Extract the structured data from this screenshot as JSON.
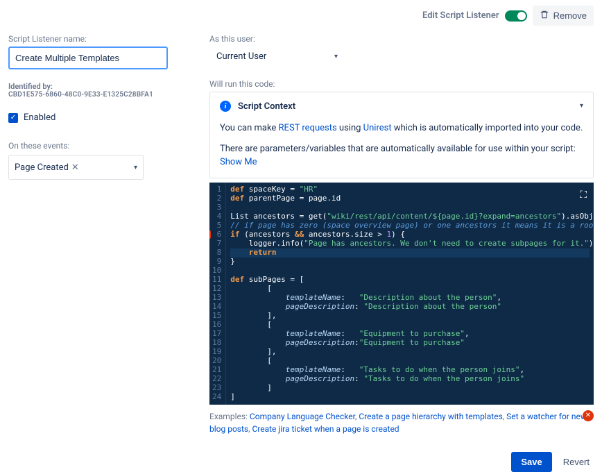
{
  "topbar": {
    "edit_label": "Edit Script Listener",
    "remove_label": "Remove"
  },
  "left": {
    "name_label": "Script Listener name:",
    "name_value": "Create Multiple Templates",
    "identified_label": "Identified by:",
    "guid": "CBD1E575-6860-48C0-9E33-E1325C28BFA1",
    "enabled_label": "Enabled",
    "events_label": "On these events:",
    "event_tag": "Page Created"
  },
  "right": {
    "user_label": "As this user:",
    "user_value": "Current User",
    "code_label": "Will run this code:",
    "ctx_title": "Script Context",
    "ctx_line1_pre": "You can make ",
    "ctx_line1_link1": "REST requests",
    "ctx_line1_mid": " using ",
    "ctx_line1_link2": "Unirest",
    "ctx_line1_post": " which is automatically imported into your code.",
    "ctx_line2_pre": "There are parameters/variables that are automatically available for use within your script: ",
    "ctx_line2_link": "Show Me"
  },
  "code": {
    "lines": [
      {
        "n": "1",
        "html": "<span class='kw'>def</span> <span class='plain'>spaceKey =</span> <span class='str'>\"HR\"</span>"
      },
      {
        "n": "2",
        "html": "<span class='kw'>def</span> <span class='plain'>parentPage = page.id</span>"
      },
      {
        "n": "3",
        "html": ""
      },
      {
        "n": "4",
        "html": "<span class='plain'>List ancestors = get(</span><span class='str'>\"wiki/rest/api/content/${page.id}?expand=ancestors\"</span><span class='plain'>).asObject(Map).body</span>"
      },
      {
        "n": "5",
        "html": "<span class='comment'>// if page has zero (space overview page) or one ancestors it means it is a root page</span>"
      },
      {
        "n": "6",
        "err": true,
        "html": "<span class='kw'>if</span> <span class='plain'>(ancestors </span><span class='kw'>&&</span><span class='plain'> ancestors.size &gt; </span><span class='num'>1</span><span class='plain'>) {</span>"
      },
      {
        "n": "7",
        "html": "    <span class='plain'>logger.info(</span><span class='str'>\"Page has ancestors. We don't need to create subpages for it.\"</span><span class='plain'>)</span>"
      },
      {
        "n": "8",
        "active": true,
        "html": "    <span class='kw'>return</span>"
      },
      {
        "n": "9",
        "html": "<span class='plain'>}</span>"
      },
      {
        "n": "10",
        "html": ""
      },
      {
        "n": "11",
        "html": "<span class='kw'>def</span> <span class='plain'>subPages = [</span>"
      },
      {
        "n": "12",
        "html": "        <span class='plain'>[</span>"
      },
      {
        "n": "13",
        "html": "            <span class='prop'>templateName</span><span class='plain'>:   </span><span class='str'>\"Description about the person\"</span><span class='plain'>,</span>"
      },
      {
        "n": "14",
        "html": "            <span class='prop'>pageDescription</span><span class='plain'>: </span><span class='str'>\"Description about the person\"</span>"
      },
      {
        "n": "15",
        "html": "        <span class='plain'>],</span>"
      },
      {
        "n": "16",
        "html": "        <span class='plain'>[</span>"
      },
      {
        "n": "17",
        "html": "            <span class='prop'>templateName</span><span class='plain'>:   </span><span class='str'>\"Equipment to purchase\"</span><span class='plain'>,</span>"
      },
      {
        "n": "18",
        "html": "            <span class='prop'>pageDescription</span><span class='plain'>:</span><span class='str'>\"Equipment to purchase\"</span>"
      },
      {
        "n": "19",
        "html": "        <span class='plain'>],</span>"
      },
      {
        "n": "20",
        "html": "        <span class='plain'>[</span>"
      },
      {
        "n": "21",
        "html": "            <span class='prop'>templateName</span><span class='plain'>:   </span><span class='str'>\"Tasks to do when the person joins\"</span><span class='plain'>,</span>"
      },
      {
        "n": "22",
        "html": "            <span class='prop'>pageDescription</span><span class='plain'>: </span><span class='str'>\"Tasks to do when the person joins\"</span>"
      },
      {
        "n": "23",
        "html": "        <span class='plain'>]</span>"
      },
      {
        "n": "24",
        "html": "<span class='plain'>]</span>"
      }
    ]
  },
  "examples": {
    "label": "Examples: ",
    "links": [
      "Company Language Checker",
      "Create a page hierarchy with templates",
      "Set a watcher for new blog posts",
      "Create jira ticket when a page is created"
    ]
  },
  "footer": {
    "save": "Save",
    "revert": "Revert"
  }
}
